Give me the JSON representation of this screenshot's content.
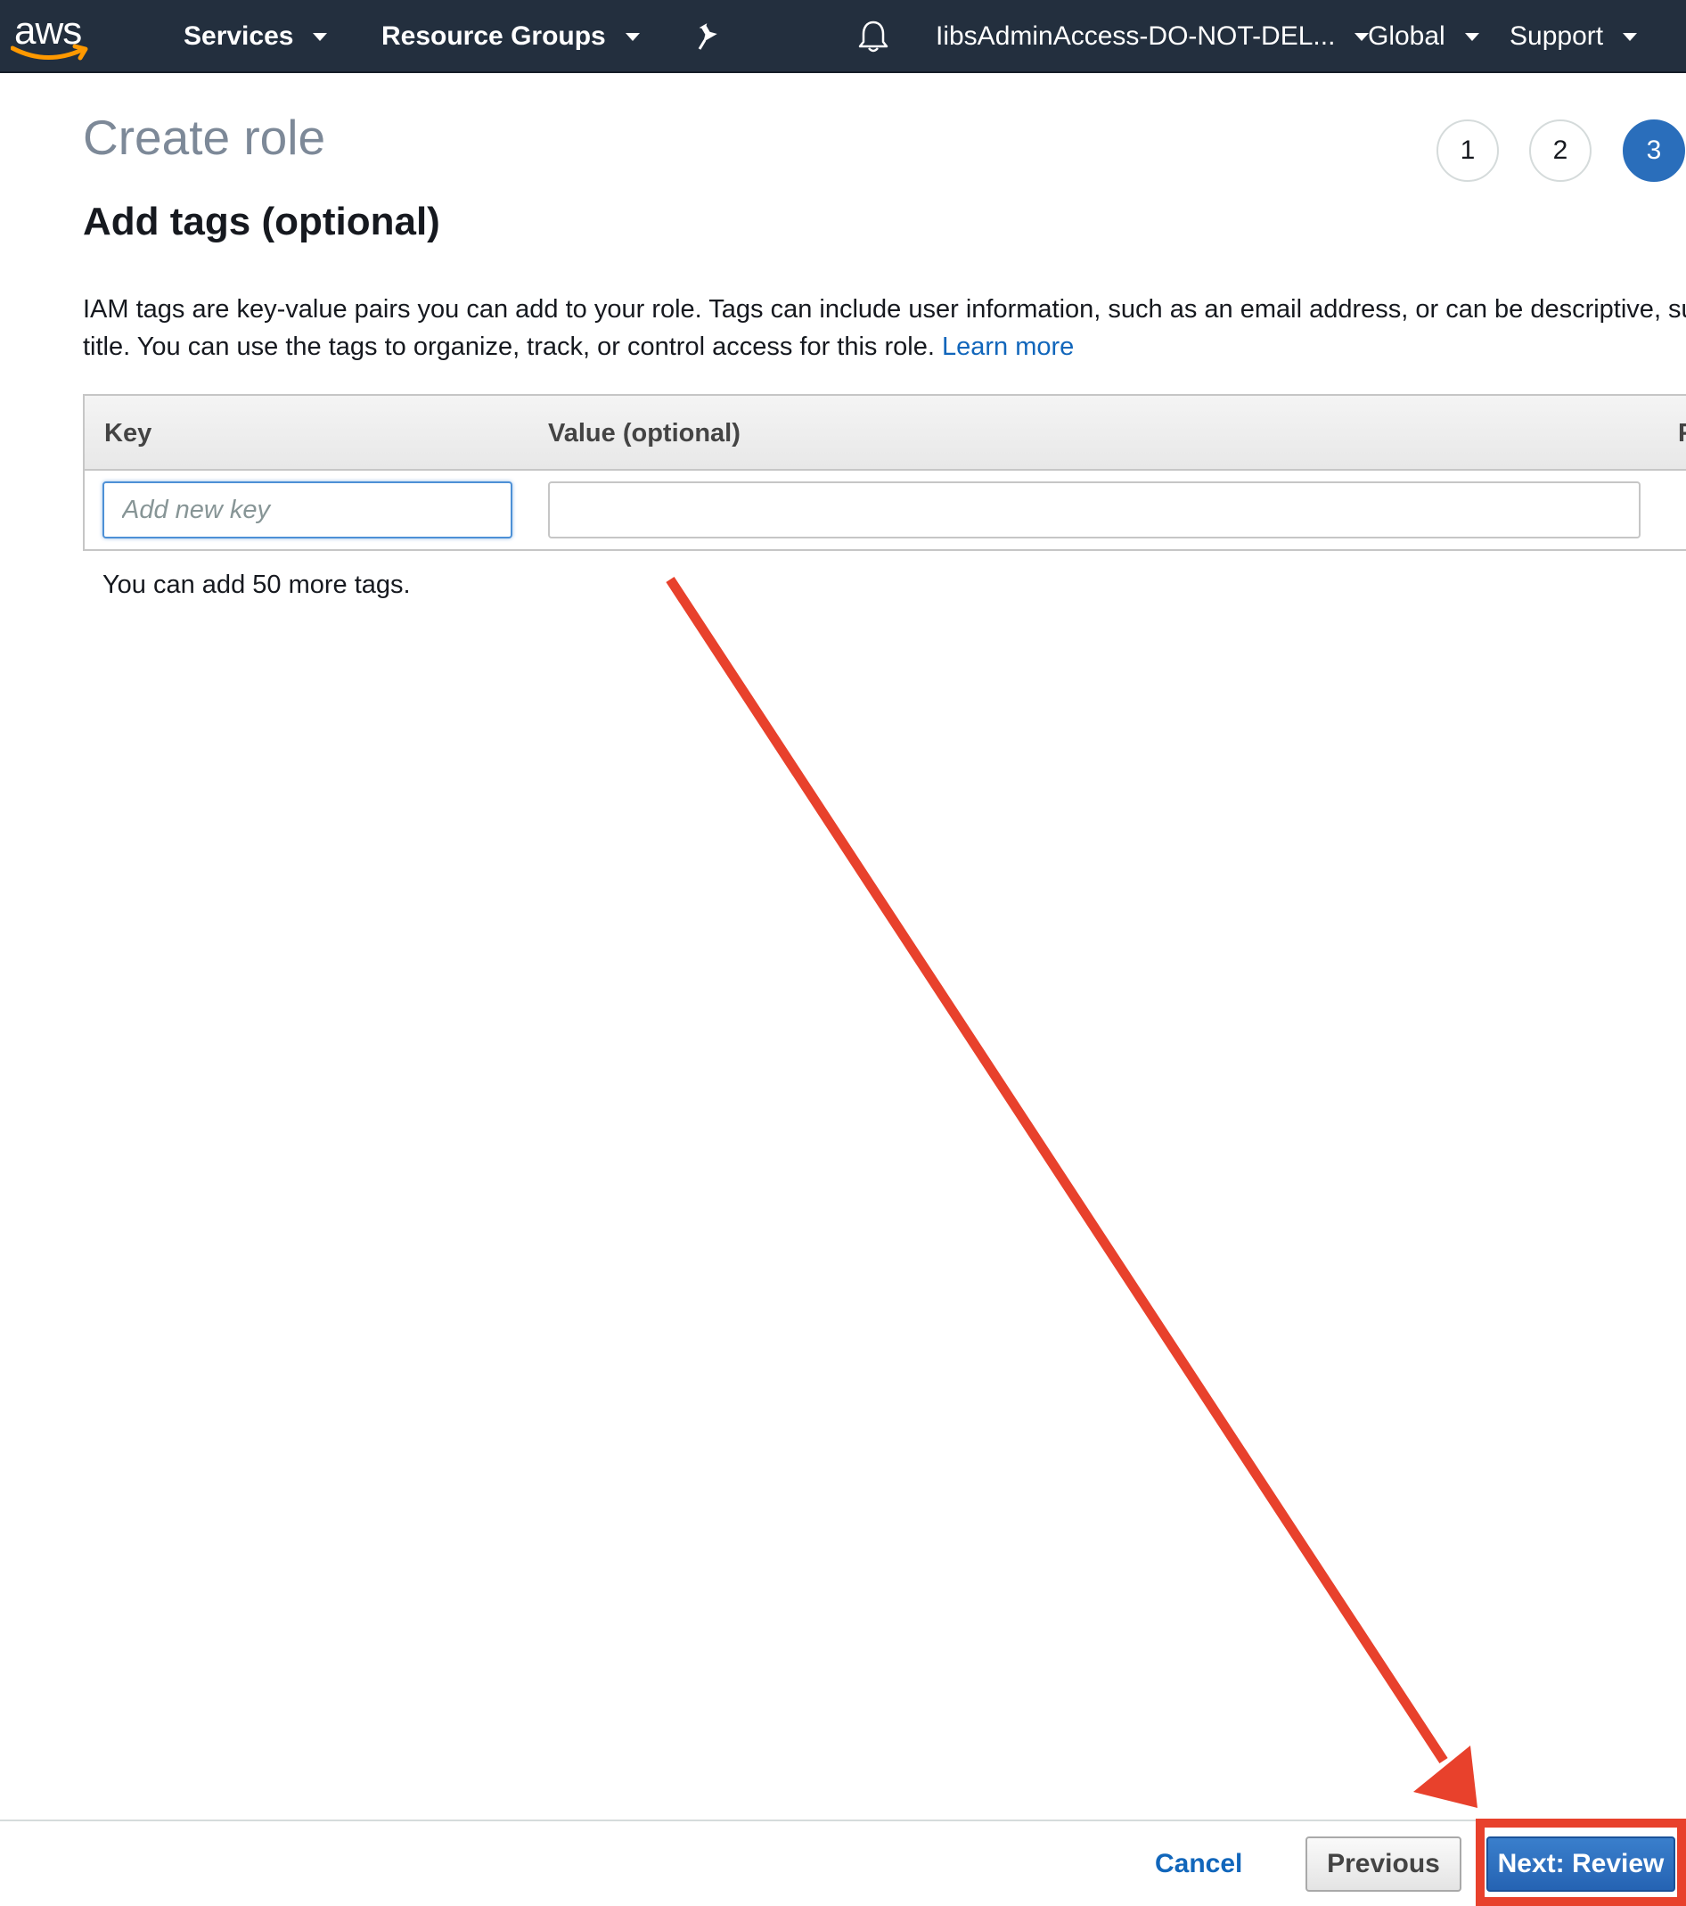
{
  "nav": {
    "logo_text": "aws",
    "services": "Services",
    "resource_groups": "Resource Groups",
    "account": "IibsAdminAccess-DO-NOT-DEL...",
    "region": "Global",
    "support": "Support"
  },
  "page": {
    "title": "Create role",
    "steps": [
      "1",
      "2",
      "3"
    ],
    "active_step": "3",
    "section_title": "Add tags (optional)",
    "description_line1": "IAM tags are key-value pairs you can add to your role. Tags can include user information, such as an email address, or can be descriptive, such",
    "description_line2": "title. You can use the tags to organize, track, or control access for this role.",
    "learn_more": "Learn more"
  },
  "tags_table": {
    "columns": [
      "Key",
      "Value (optional)",
      "F"
    ],
    "key_placeholder": "Add new key",
    "key_value": "",
    "value_value": "",
    "remaining_text": "You can add 50 more tags."
  },
  "footer": {
    "cancel": "Cancel",
    "previous": "Previous",
    "next": "Next: Review"
  },
  "colors": {
    "nav_bg": "#232f3e",
    "primary": "#2a6ebb",
    "link": "#1166bb",
    "annotation": "#e8412c",
    "logo_smile": "#ff9900"
  },
  "icons": [
    "pin-icon",
    "bell-icon",
    "chevron-down-icon"
  ]
}
